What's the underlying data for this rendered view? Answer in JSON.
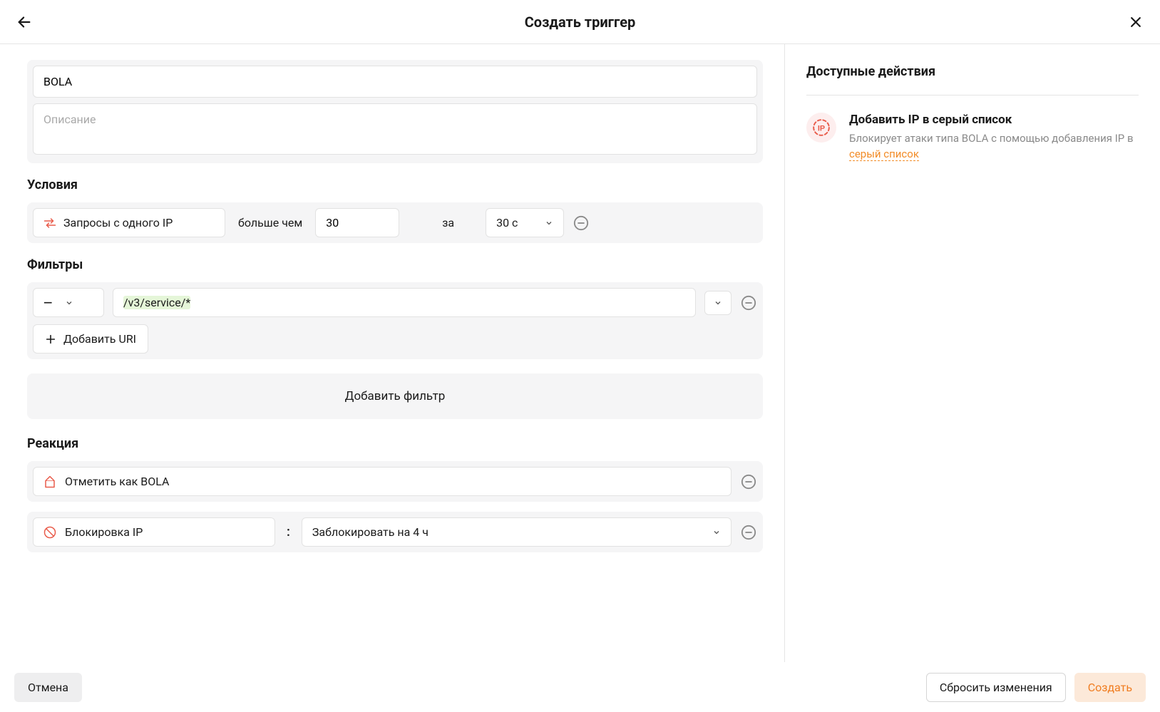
{
  "header": {
    "title": "Создать триггер"
  },
  "form": {
    "name_value": "BOLA",
    "description_placeholder": "Описание"
  },
  "conditions": {
    "heading": "Условия",
    "metric_label": "Запросы с одного IP",
    "comparator": "больше чем",
    "threshold": "30",
    "per_label": "за",
    "window": "30 с"
  },
  "filters": {
    "heading": "Фильтры",
    "operator": "—",
    "uri_value": "/v3/service/*",
    "add_uri_label": "Добавить URI",
    "add_filter_label": "Добавить фильтр"
  },
  "reactions": {
    "heading": "Реакция",
    "items": [
      {
        "label": "Отметить как BOLA"
      },
      {
        "label": "Блокировка IP",
        "duration": "Заблокировать на 4 ч"
      }
    ]
  },
  "sidebar": {
    "title": "Доступные действия",
    "action": {
      "title": "Добавить IP в серый список",
      "desc_prefix": "Блокирует атаки типа BOLA с помощью добавления IP в ",
      "desc_link": "серый список"
    }
  },
  "footer": {
    "cancel": "Отмена",
    "reset": "Сбросить изменения",
    "submit": "Создать"
  }
}
